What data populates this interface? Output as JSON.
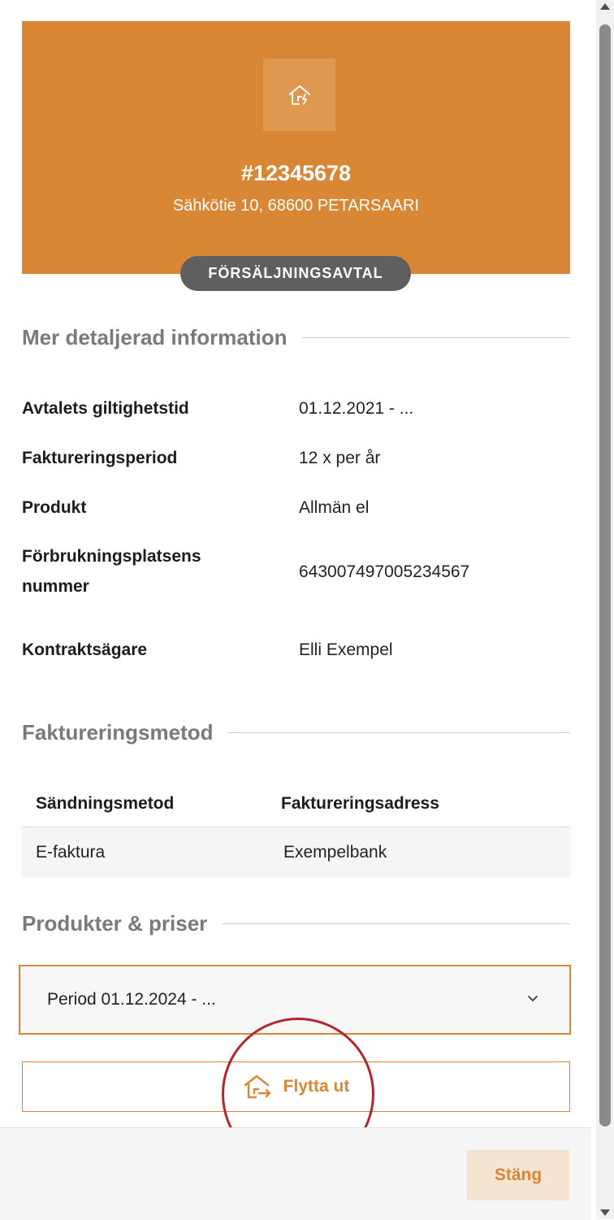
{
  "hero": {
    "icon": "house-electricity-icon",
    "contract_id": "#12345678",
    "address": "Sähkötie 10, 68600 PETARSAARI",
    "badge": "FÖRSÄLJNINGSAVTAL"
  },
  "details": {
    "heading": "Mer detaljerad information",
    "rows": [
      {
        "label": "Avtalets giltighetstid",
        "value": "01.12.2021 - ..."
      },
      {
        "label": "Faktureringsperiod",
        "value": "12 x per år"
      },
      {
        "label": "Produkt",
        "value": "Allmän el"
      },
      {
        "label": "Förbrukningsplatsens nummer",
        "value": "643007497005234567"
      },
      {
        "label": "Kontraktsägare",
        "value": "Elli Exempel"
      }
    ]
  },
  "billing": {
    "heading": "Faktureringsmetod",
    "columns": [
      "Sändningsmetod",
      "Faktureringsadress"
    ],
    "rows": [
      [
        "E-faktura",
        "Exempelbank"
      ]
    ]
  },
  "products": {
    "heading": "Produkter & priser",
    "selected_period": "Period 01.12.2024 - ...",
    "chevron_icon": "chevron-down-icon"
  },
  "actions": {
    "move_out_label": "Flytta ut",
    "move_out_icon": "house-move-out-icon",
    "close_label": "Stäng"
  },
  "colors": {
    "accent": "#d98734",
    "badge": "#5f5f5f",
    "annotation": "#b3262b"
  }
}
